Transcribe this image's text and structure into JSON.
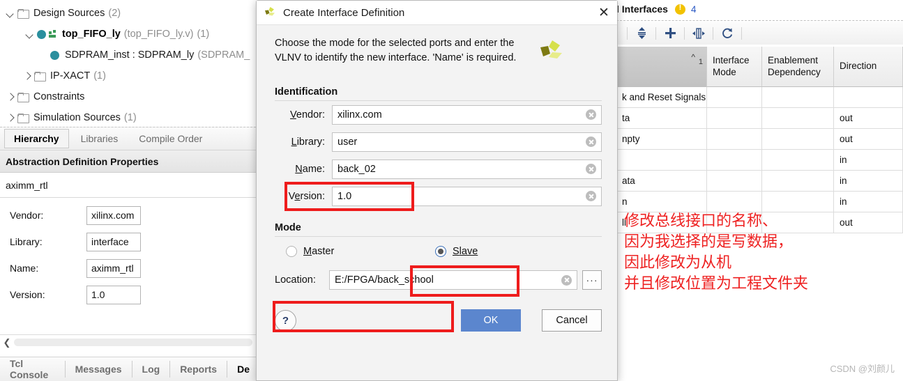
{
  "left_panel": {
    "tree": [
      {
        "indent": 0,
        "twisty": "down",
        "icon": "folder",
        "label": "Design Sources",
        "count": "(2)",
        "bold": false
      },
      {
        "indent": 1,
        "twisty": "down",
        "icon": "module",
        "label": "top_FIFO_ly",
        "sub": "(top_FIFO_ly.v)",
        "count": "(1)",
        "bold": true
      },
      {
        "indent": 2,
        "twisty": "none",
        "icon": "instance",
        "label": "SDPRAM_inst : SDPRAM_ly",
        "sub": "(SDPRAM_",
        "count": "",
        "bold": false
      },
      {
        "indent": 1,
        "twisty": "right",
        "icon": "folder",
        "label": "IP-XACT",
        "count": "(1)",
        "bold": false
      },
      {
        "indent": 0,
        "twisty": "right",
        "icon": "folder",
        "label": "Constraints",
        "count": "",
        "bold": false
      },
      {
        "indent": 0,
        "twisty": "right",
        "icon": "folder",
        "label": "Simulation Sources",
        "count": "(1)",
        "bold": false
      }
    ],
    "tree_tabs": [
      {
        "label": "Hierarchy",
        "active": true
      },
      {
        "label": "Libraries",
        "active": false
      },
      {
        "label": "Compile Order",
        "active": false
      }
    ],
    "properties": {
      "header": "Abstraction Definition Properties",
      "name_value": "aximm_rtl",
      "fields": [
        {
          "label": "Vendor:",
          "value": "xilinx.com"
        },
        {
          "label": "Library:",
          "value": "interface"
        },
        {
          "label": "Name:",
          "value": "aximm_rtl"
        },
        {
          "label": "Version:",
          "value": "1.0"
        }
      ]
    },
    "bottom_tabs": [
      {
        "label": "Tcl Console",
        "active": false
      },
      {
        "label": "Messages",
        "active": false
      },
      {
        "label": "Log",
        "active": false
      },
      {
        "label": "Reports",
        "active": false
      },
      {
        "label": "De",
        "active": true
      }
    ]
  },
  "right_panel": {
    "title": "l Interfaces",
    "warning_count": "4",
    "toolbar": [
      {
        "name": "sort-icon",
        "glyph": "⇅"
      },
      {
        "name": "add-icon",
        "glyph": "+"
      },
      {
        "name": "fit-width-icon",
        "glyph": "⬌"
      },
      {
        "name": "refresh-icon",
        "glyph": "↻"
      }
    ],
    "table": {
      "columns": [
        "",
        "Interface\nMode",
        "Enablement\nDependency",
        "Direction"
      ],
      "sort_index": "1",
      "rows": [
        {
          "name": "k and Reset Signals",
          "mode": "",
          "enablement": "",
          "direction": ""
        },
        {
          "name": "ta",
          "mode": "",
          "enablement": "",
          "direction": "out"
        },
        {
          "name": "npty",
          "mode": "",
          "enablement": "",
          "direction": "out"
        },
        {
          "name": "",
          "mode": "",
          "enablement": "",
          "direction": "in"
        },
        {
          "name": "ata",
          "mode": "",
          "enablement": "",
          "direction": "in"
        },
        {
          "name": "n",
          "mode": "",
          "enablement": "",
          "direction": "in"
        },
        {
          "name": "ll",
          "mode": "",
          "enablement": "",
          "direction": "out"
        }
      ]
    },
    "annotation": "修改总线接口的名称、\n因为我选择的是写数据，\n因此修改为从机\n并且修改位置为工程文件夹",
    "watermark": "CSDN @刘颜儿"
  },
  "dialog": {
    "title": "Create Interface Definition",
    "close_label": "✕",
    "description": "Choose the mode for the selected ports and enter the VLNV to identify the new interface. 'Name' is required.",
    "identification_label": "Identification",
    "fields": [
      {
        "label_pre": "",
        "label_mn": "V",
        "label_post": "endor:",
        "value": "xilinx.com"
      },
      {
        "label_pre": "",
        "label_mn": "L",
        "label_post": "ibrary:",
        "value": "user"
      },
      {
        "label_pre": "",
        "label_mn": "N",
        "label_post": "ame:",
        "value": "back_02"
      },
      {
        "label_pre": "V",
        "label_mn": "e",
        "label_post": "rsion:",
        "value": "1.0"
      }
    ],
    "mode_label": "Mode",
    "modes": [
      {
        "mn": "M",
        "rest": "aster",
        "checked": false
      },
      {
        "mn": "S",
        "rest": "lave",
        "checked": true
      }
    ],
    "location_label": "Location:",
    "location_value": "E:/FPGA/back_school",
    "browse_label": "···",
    "help_label": "?",
    "ok_label": "OK",
    "cancel_label": "Cancel"
  },
  "colors": {
    "annotation_red": "#ee2222",
    "primary_button": "#5b86ce",
    "warning_yellow": "#f2c200",
    "tree_node_teal": "#2a8f9e",
    "xilinx_olive": "#7d7a13",
    "xilinx_lime": "#d6e04b"
  }
}
